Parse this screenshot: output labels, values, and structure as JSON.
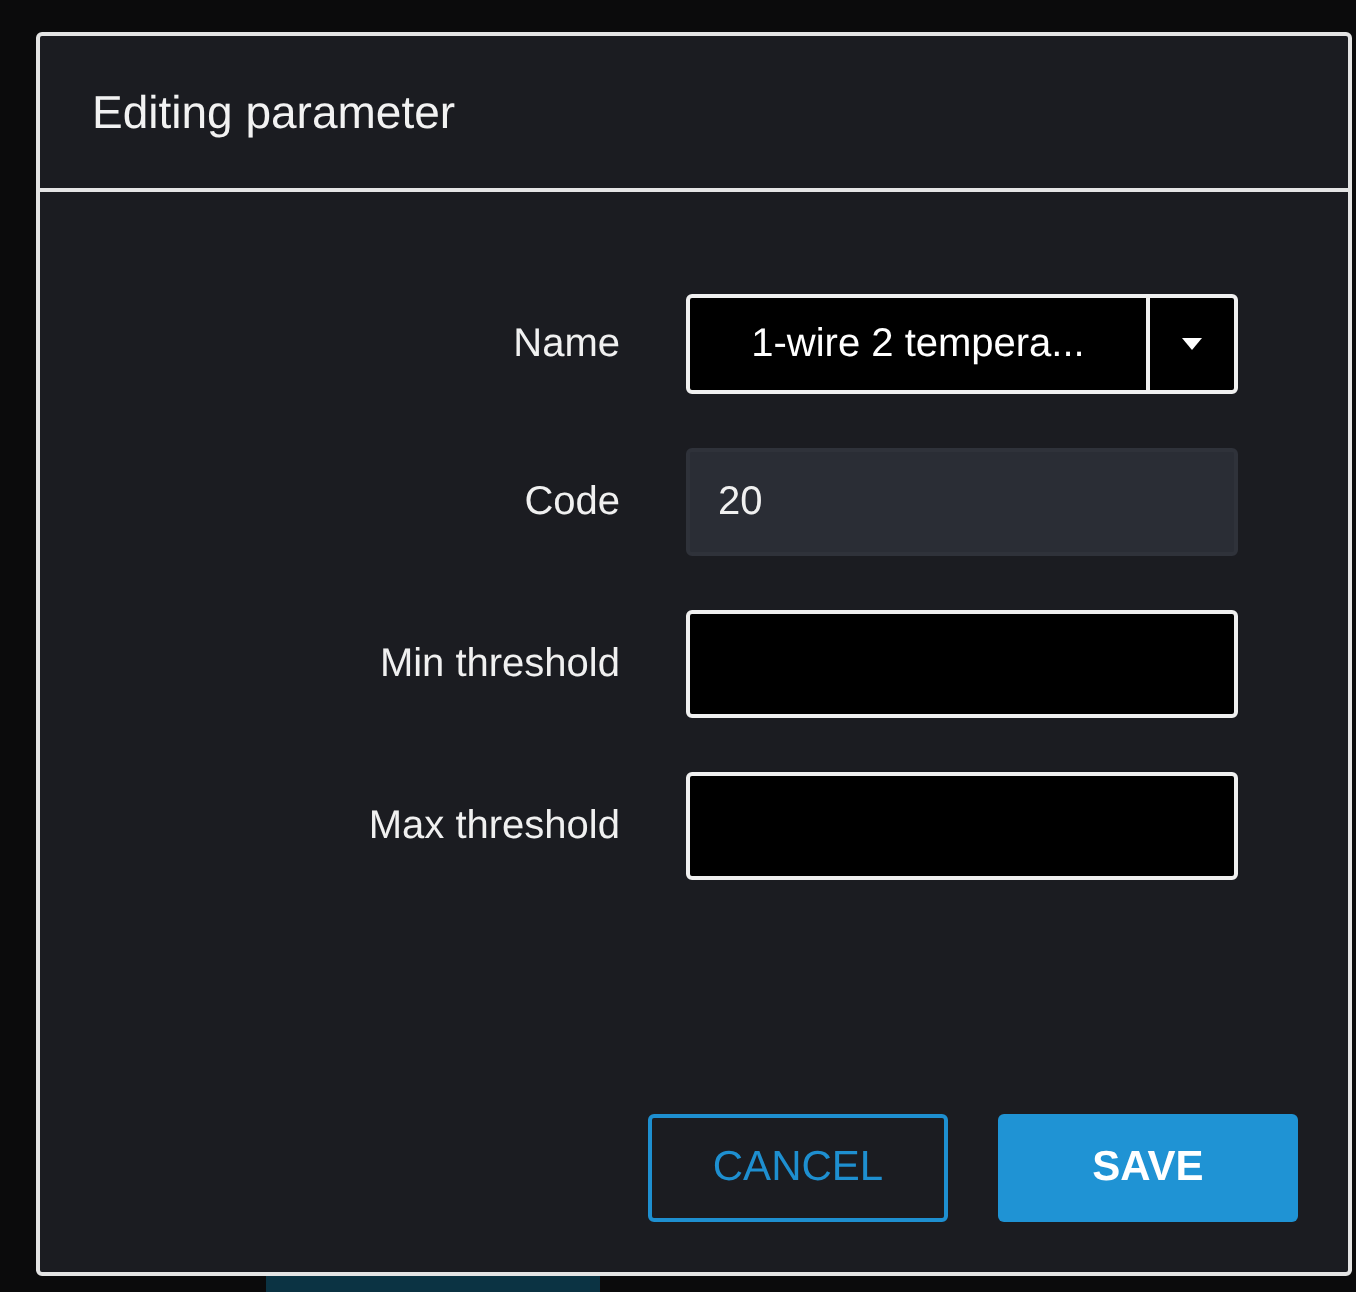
{
  "dialog": {
    "title": "Editing parameter",
    "fields": [
      {
        "label": "Name",
        "kind": "select",
        "value": "1-wire 2 tempera...",
        "disabled": false
      },
      {
        "label": "Code",
        "kind": "input",
        "value": "20",
        "disabled": true
      },
      {
        "label": "Min threshold",
        "kind": "input",
        "disabled": false
      },
      {
        "label": "Max threshold",
        "kind": "input",
        "disabled": false
      }
    ],
    "buttons": [
      {
        "label": "CANCEL",
        "kind": "outline"
      },
      {
        "label": "SAVE",
        "kind": "primary"
      }
    ]
  }
}
